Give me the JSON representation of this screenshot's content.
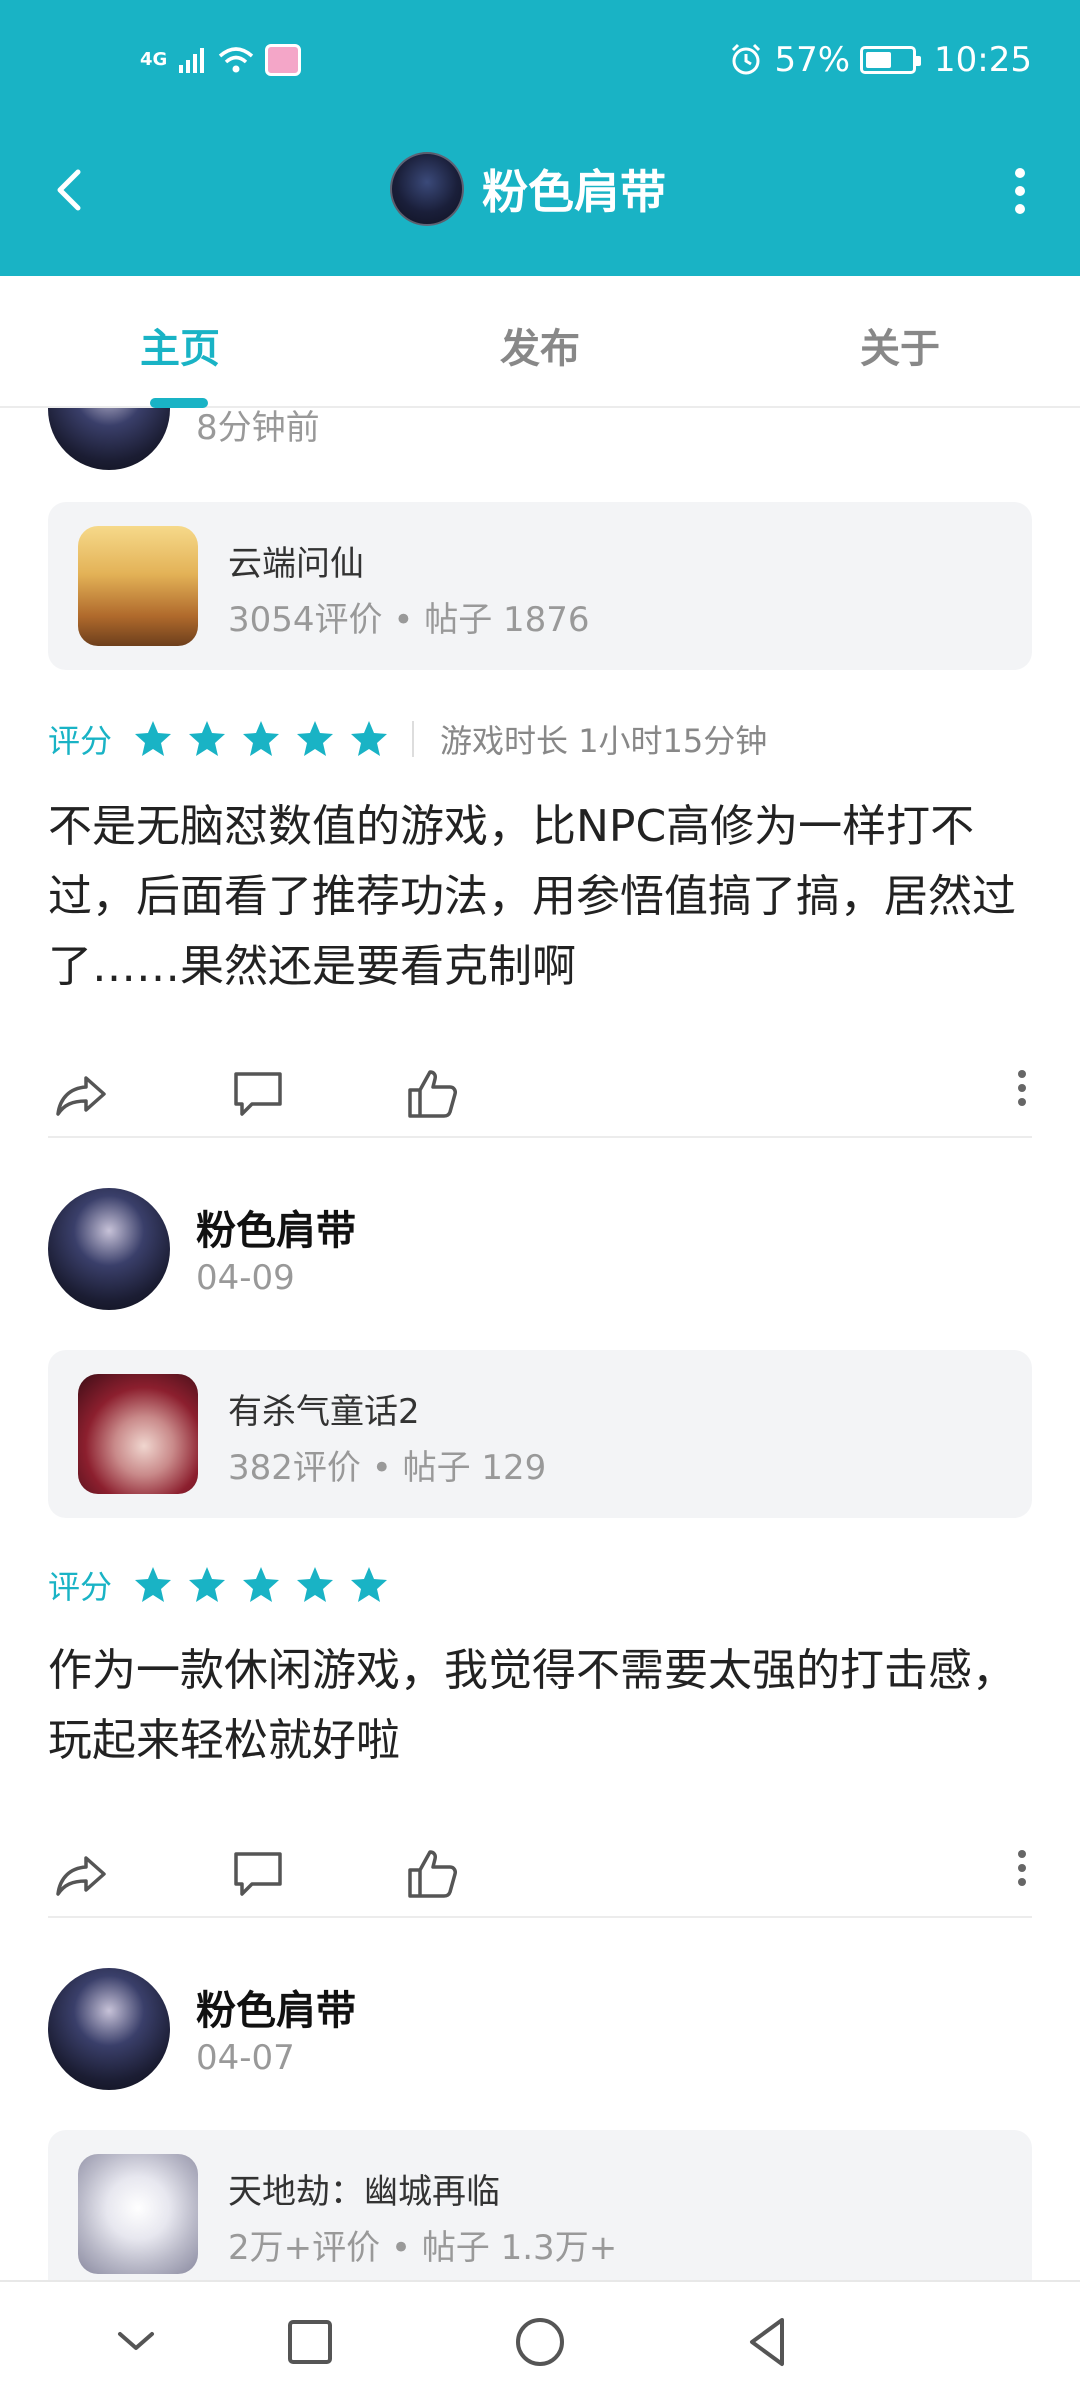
{
  "status_bar": {
    "network": "4G",
    "battery_percent": "57%",
    "battery_level": 0.57,
    "time": "10:25"
  },
  "appbar": {
    "title": "粉色肩带"
  },
  "tabs": [
    {
      "label": "主页",
      "active": true
    },
    {
      "label": "发布",
      "active": false
    },
    {
      "label": "关于",
      "active": false
    }
  ],
  "posts": [
    {
      "time": "8分钟前",
      "game": {
        "name": "云端问仙",
        "reviews": "3054评价",
        "posts": "帖子 1876"
      },
      "rating_label": "评分",
      "stars": 5,
      "playtime": "游戏时长 1小时15分钟",
      "text": "不是无脑怼数值的游戏，比NPC高修为一样打不过，后面看了推荐功法，用参悟值搞了搞，居然过了……果然还是要看克制啊"
    },
    {
      "username": "粉色肩带",
      "time": "04-09",
      "game": {
        "name": "有杀气童话2",
        "reviews": "382评价",
        "posts": "帖子 129"
      },
      "rating_label": "评分",
      "stars": 5,
      "text": "作为一款休闲游戏，我觉得不需要太强的打击感，玩起来轻松就好啦"
    },
    {
      "username": "粉色肩带",
      "time": "04-07",
      "game": {
        "name": "天地劫：幽城再临",
        "reviews": "2万+评价",
        "posts": "帖子 1.3万+"
      }
    }
  ],
  "separator_dot": "•",
  "colors": {
    "accent": "#19b3c5",
    "card_bg": "#f3f4f6"
  }
}
